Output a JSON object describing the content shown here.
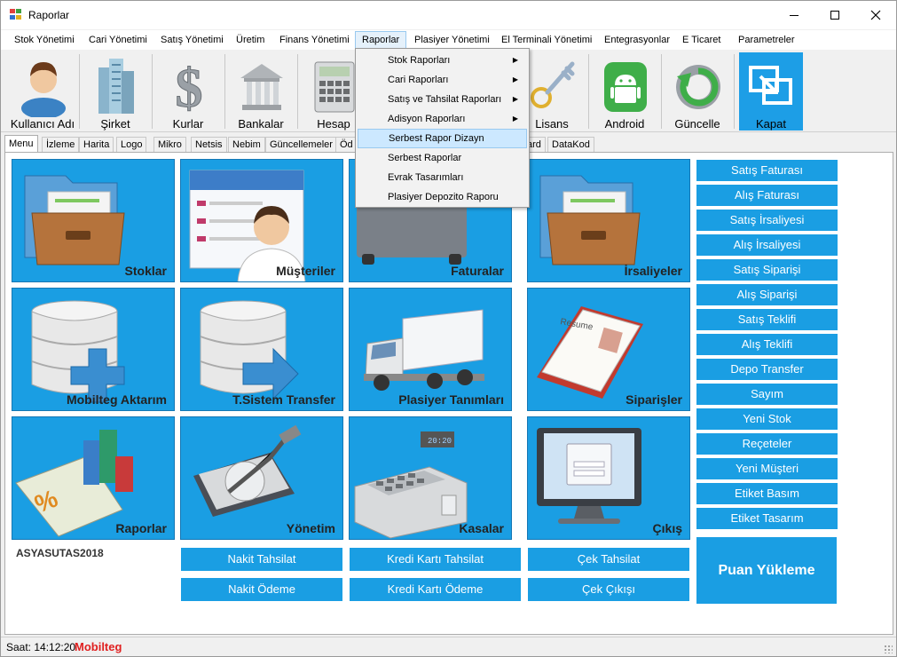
{
  "window": {
    "title": "Raporlar"
  },
  "menubar": [
    {
      "label": "Stok Yönetimi"
    },
    {
      "label": "Cari Yönetimi"
    },
    {
      "label": "Satış Yönetimi"
    },
    {
      "label": "Üretim"
    },
    {
      "label": "Finans Yönetimi"
    },
    {
      "label": "Raporlar"
    },
    {
      "label": "Plasiyer Yönetimi"
    },
    {
      "label": "El Terminali Yönetimi"
    },
    {
      "label": "Entegrasyonlar"
    },
    {
      "label": "E Ticaret"
    },
    {
      "label": "Parametreler"
    }
  ],
  "toolbar": [
    {
      "label": "Kullanıcı Adı",
      "icon": "user-icon"
    },
    {
      "label": "Şirket",
      "icon": "buildings-icon"
    },
    {
      "label": "Kurlar",
      "icon": "dollar-icon"
    },
    {
      "label": "Bankalar",
      "icon": "bank-icon"
    },
    {
      "label": "Hesap",
      "icon": "calculator-icon"
    },
    {
      "label": "Lisans",
      "icon": "key-icon"
    },
    {
      "label": "Android",
      "icon": "android-icon"
    },
    {
      "label": "Güncelle",
      "icon": "refresh-icon"
    },
    {
      "label": "Kapat",
      "icon": "exit-icon"
    }
  ],
  "tabs": [
    {
      "label": "Menu"
    },
    {
      "label": "İzleme"
    },
    {
      "label": "Harita"
    },
    {
      "label": "Logo"
    },
    {
      "label": "Mikro"
    },
    {
      "label": "Netsis"
    },
    {
      "label": "Nebim"
    },
    {
      "label": "Güncellemeler"
    },
    {
      "label": "Öd"
    },
    {
      "label": "ard"
    },
    {
      "label": "DataKod"
    }
  ],
  "dropdown": [
    {
      "label": "Stok Raporları",
      "submenu": true
    },
    {
      "label": "Cari Raporları",
      "submenu": true
    },
    {
      "label": "Satış ve Tahsilat Raporları",
      "submenu": true
    },
    {
      "label": "Adisyon Raporları",
      "submenu": true
    },
    {
      "label": "Serbest Rapor Dizayn",
      "submenu": false
    },
    {
      "label": "Serbest Raporlar",
      "submenu": false
    },
    {
      "label": "Evrak Tasarımları",
      "submenu": false
    },
    {
      "label": "Plasiyer Depozito Raporu",
      "submenu": false
    }
  ],
  "tiles": [
    {
      "label": "Stoklar",
      "icon": "folder-icon"
    },
    {
      "label": "Müşteriler",
      "icon": "customer-card-icon"
    },
    {
      "label": "Faturalar",
      "icon": "printer-icon"
    },
    {
      "label": "İrsaliyeler",
      "icon": "folder-icon"
    },
    {
      "label": "Mobilteg Aktarım",
      "icon": "database-add-icon"
    },
    {
      "label": "T.Sistem Transfer",
      "icon": "database-transfer-icon"
    },
    {
      "label": "Plasiyer Tanımları",
      "icon": "truck-icon"
    },
    {
      "label": "Siparişler",
      "icon": "resume-book-icon"
    },
    {
      "label": "Raporlar",
      "icon": "report-chart-icon"
    },
    {
      "label": "Yönetim",
      "icon": "hard-drive-icon"
    },
    {
      "label": "Kasalar",
      "icon": "cash-register-icon"
    },
    {
      "label": "Çıkış",
      "icon": "monitor-login-icon"
    }
  ],
  "side_buttons": [
    {
      "label": "Satış Faturası"
    },
    {
      "label": "Alış Faturası"
    },
    {
      "label": "Satış İrsaliyesi"
    },
    {
      "label": "Alış İrsaliyesi"
    },
    {
      "label": "Satış Siparişi"
    },
    {
      "label": "Alış Siparişi"
    },
    {
      "label": "Satış Teklifi"
    },
    {
      "label": "Alış Teklifi"
    },
    {
      "label": "Depo Transfer"
    },
    {
      "label": "Sayım"
    },
    {
      "label": "Yeni Stok"
    },
    {
      "label": "Reçeteler"
    },
    {
      "label": "Yeni Müşteri"
    },
    {
      "label": "Etiket Basım"
    },
    {
      "label": "Etiket Tasarım"
    }
  ],
  "puan_button": {
    "label": "Puan Yükleme"
  },
  "bottom_buttons": [
    {
      "label": "Nakit Tahsilat"
    },
    {
      "label": "Kredi Kartı Tahsilat"
    },
    {
      "label": "Çek Tahsilat"
    },
    {
      "label": "Nakit Ödeme"
    },
    {
      "label": "Kredi Kartı Ödeme"
    },
    {
      "label": "Çek Çıkışı"
    }
  ],
  "company": "ASYASUTAS2018",
  "status": {
    "time": "Saat: 14:12:20",
    "brand": "Mobilteg"
  },
  "colors": {
    "accent": "#1a9ee3",
    "brand_red": "#e02020",
    "menu_highlight": "#cce8ff"
  }
}
